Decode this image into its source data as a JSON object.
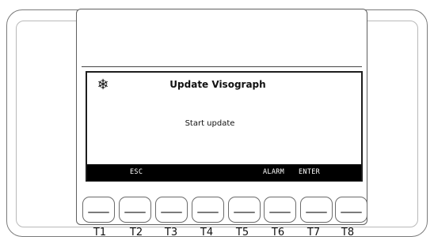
{
  "display": {
    "icon": "snowflake-icon",
    "icon_glyph": "❄",
    "title": "Update Visograph",
    "message": "Start update"
  },
  "softkeys": {
    "esc": "ESC",
    "alarm": "ALARM",
    "enter": "ENTER"
  },
  "buttons": [
    {
      "label": "T1"
    },
    {
      "label": "T2"
    },
    {
      "label": "T3"
    },
    {
      "label": "T4"
    },
    {
      "label": "T5"
    },
    {
      "label": "T6"
    },
    {
      "label": "T7"
    },
    {
      "label": "T8"
    }
  ]
}
